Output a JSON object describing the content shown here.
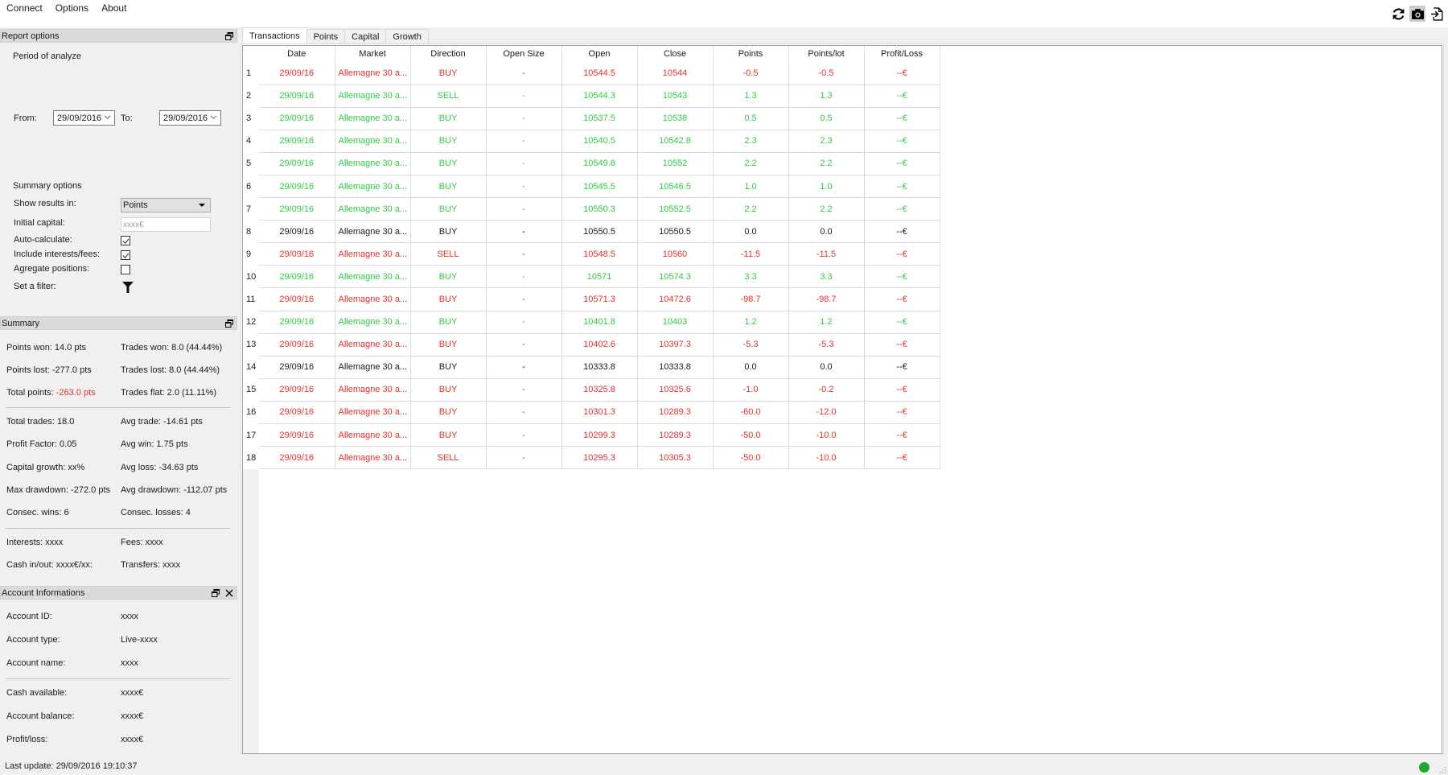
{
  "menu": [
    "Connect",
    "Options",
    "About"
  ],
  "toolbar": {
    "icons": [
      "refresh-icon",
      "camera-icon",
      "export-icon"
    ]
  },
  "report_options": {
    "title": "Report options",
    "period_label": "Period of analyze",
    "from_label": "From:",
    "from_value": "29/09/2016",
    "to_label": "To:",
    "to_value": "29/09/2016",
    "summary_options_label": "Summary options",
    "show_results_label": "Show results in:",
    "show_results_value": "Points",
    "initial_capital_label": "Initial capital:",
    "initial_capital_placeholder": "xxxx€",
    "auto_calculate_label": "Auto-calculate:",
    "auto_calculate_checked": true,
    "include_fees_label": "Include interests/fees:",
    "include_fees_checked": true,
    "aggregate_label": "Agregate positions:",
    "aggregate_checked": false,
    "filter_label": "Set a filter:"
  },
  "summary": {
    "title": "Summary",
    "points_won": "Points won: 14.0 pts",
    "trades_won": "Trades won: 8.0 (44.44%)",
    "points_lost": "Points lost: -277.0 pts",
    "trades_lost": "Trades lost: 8.0 (44.44%)",
    "total_points_label": "Total points: ",
    "total_points_value": "-263.0 pts",
    "trades_flat": "Trades flat: 2.0 (11.11%)",
    "total_trades": "Total trades: 18.0",
    "avg_trade": "Avg trade: -14.61 pts",
    "profit_factor": "Profit Factor: 0.05",
    "avg_win": "Avg win: 1.75 pts",
    "capital_growth": "Capital growth: xx%",
    "avg_loss": "Avg loss: -34.63 pts",
    "max_drawdown": "Max drawdown: -272.0 pts",
    "avg_drawdown": "Avg drawdown: -112.07 pts",
    "consec_wins": "Consec. wins: 6",
    "consec_losses": "Consec. losses: 4",
    "interests": "Interests: xxxx",
    "fees": "Fees: xxxx",
    "cash_in_out": "Cash in/out: xxxx€/xx:",
    "transfers": "Transfers: xxxx"
  },
  "account": {
    "title": "Account Informations",
    "rows_top": [
      {
        "label": "Account ID:",
        "value": "xxxx"
      },
      {
        "label": "Account type:",
        "value": "Live-xxxx"
      },
      {
        "label": "Account name:",
        "value": "xxxx"
      }
    ],
    "rows_bottom": [
      {
        "label": "Cash available:",
        "value": "xxxx€"
      },
      {
        "label": "Account balance:",
        "value": "xxxx€"
      },
      {
        "label": "Profit/loss:",
        "value": "xxxx€"
      }
    ]
  },
  "tabs": [
    "Transactions",
    "Points",
    "Capital",
    "Growth"
  ],
  "active_tab": "Transactions",
  "table": {
    "columns": [
      "Date",
      "Market",
      "Direction",
      "Open Size",
      "Open",
      "Close",
      "Points",
      "Points/lot",
      "Profit/Loss"
    ],
    "colors": {
      "red": "#e8302a",
      "green": "#2ecc40",
      "black": "#1a1a1a"
    },
    "rows": [
      {
        "n": "1",
        "status": "red",
        "cells": [
          "29/09/16",
          "Allemagne 30 a...",
          "BUY",
          "-",
          "10544.5",
          "10544",
          "-0.5",
          "-0.5",
          "--€"
        ]
      },
      {
        "n": "2",
        "status": "green",
        "cells": [
          "29/09/16",
          "Allemagne 30 a...",
          "SELL",
          "-",
          "10544.3",
          "10543",
          "1.3",
          "1.3",
          "--€"
        ]
      },
      {
        "n": "3",
        "status": "green",
        "cells": [
          "29/09/16",
          "Allemagne 30 a...",
          "BUY",
          "-",
          "10537.5",
          "10538",
          "0.5",
          "0.5",
          "--€"
        ]
      },
      {
        "n": "4",
        "status": "green",
        "cells": [
          "29/09/16",
          "Allemagne 30 a...",
          "BUY",
          "-",
          "10540.5",
          "10542.8",
          "2.3",
          "2.3",
          "--€"
        ]
      },
      {
        "n": "5",
        "status": "green",
        "cells": [
          "29/09/16",
          "Allemagne 30 a...",
          "BUY",
          "-",
          "10549.8",
          "10552",
          "2.2",
          "2.2",
          "--€"
        ]
      },
      {
        "n": "6",
        "status": "green",
        "cells": [
          "29/09/16",
          "Allemagne 30 a...",
          "BUY",
          "-",
          "10545.5",
          "10546.5",
          "1.0",
          "1.0",
          "--€"
        ]
      },
      {
        "n": "7",
        "status": "green",
        "cells": [
          "29/09/16",
          "Allemagne 30 a...",
          "BUY",
          "-",
          "10550.3",
          "10552.5",
          "2.2",
          "2.2",
          "--€"
        ]
      },
      {
        "n": "8",
        "status": "black",
        "cells": [
          "29/09/16",
          "Allemagne 30 a...",
          "BUY",
          "-",
          "10550.5",
          "10550.5",
          "0.0",
          "0.0",
          "--€"
        ]
      },
      {
        "n": "9",
        "status": "red",
        "cells": [
          "29/09/16",
          "Allemagne 30 a...",
          "SELL",
          "-",
          "10548.5",
          "10560",
          "-11.5",
          "-11.5",
          "--€"
        ]
      },
      {
        "n": "10",
        "status": "green",
        "cells": [
          "29/09/16",
          "Allemagne 30 a...",
          "BUY",
          "-",
          "10571",
          "10574.3",
          "3.3",
          "3.3",
          "--€"
        ]
      },
      {
        "n": "11",
        "status": "red",
        "cells": [
          "29/09/16",
          "Allemagne 30 a...",
          "BUY",
          "-",
          "10571.3",
          "10472.6",
          "-98.7",
          "-98.7",
          "--€"
        ]
      },
      {
        "n": "12",
        "status": "green",
        "cells": [
          "29/09/16",
          "Allemagne 30 a...",
          "BUY",
          "-",
          "10401.8",
          "10403",
          "1.2",
          "1.2",
          "--€"
        ]
      },
      {
        "n": "13",
        "status": "red",
        "cells": [
          "29/09/16",
          "Allemagne 30 a...",
          "BUY",
          "-",
          "10402.6",
          "10397.3",
          "-5.3",
          "-5.3",
          "--€"
        ]
      },
      {
        "n": "14",
        "status": "black",
        "cells": [
          "29/09/16",
          "Allemagne 30 a...",
          "BUY",
          "-",
          "10333.8",
          "10333.8",
          "0.0",
          "0.0",
          "--€"
        ]
      },
      {
        "n": "15",
        "status": "red",
        "cells": [
          "29/09/16",
          "Allemagne 30 a...",
          "BUY",
          "-",
          "10325.8",
          "10325.6",
          "-1.0",
          "-0.2",
          "--€"
        ]
      },
      {
        "n": "16",
        "status": "red",
        "cells": [
          "29/09/16",
          "Allemagne 30 a...",
          "BUY",
          "-",
          "10301.3",
          "10289.3",
          "-60.0",
          "-12.0",
          "--€"
        ]
      },
      {
        "n": "17",
        "status": "red",
        "cells": [
          "29/09/16",
          "Allemagne 30 a...",
          "BUY",
          "-",
          "10299.3",
          "10289.3",
          "-50.0",
          "-10.0",
          "--€"
        ]
      },
      {
        "n": "18",
        "status": "red",
        "cells": [
          "29/09/16",
          "Allemagne 30 a...",
          "SELL",
          "-",
          "10295.3",
          "10305.3",
          "-50.0",
          "-10.0",
          "--€"
        ]
      }
    ]
  },
  "status": {
    "last_update": "Last update: 29/09/2016 19:10:37",
    "connection": "connected"
  }
}
